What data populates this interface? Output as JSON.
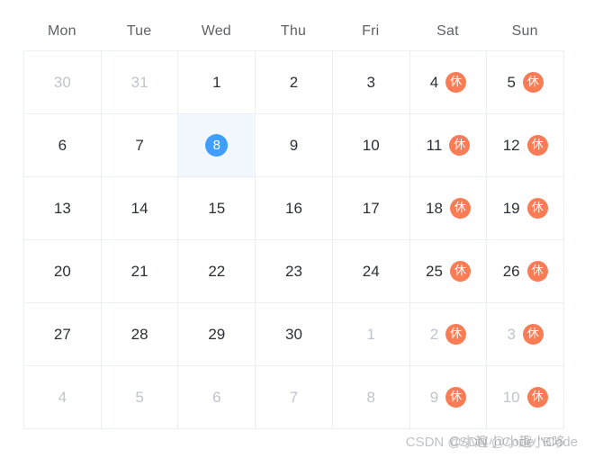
{
  "calendar": {
    "weekdays": [
      "Mon",
      "Tue",
      "Wed",
      "Thu",
      "Fri",
      "Sat",
      "Sun"
    ],
    "holiday_label": "休",
    "today": "8",
    "colors": {
      "today_accent": "#409EFF",
      "today_cell_bg": "#F2F8FE",
      "holiday_badge": "#FA7C55",
      "grid_border": "#EBEEF5",
      "text": "#2C2F34",
      "text_muted": "#C0C4CC",
      "weekday_text": "#606266"
    },
    "rows": [
      [
        {
          "day": "30",
          "adjacent": true,
          "today": false,
          "holiday": false
        },
        {
          "day": "31",
          "adjacent": true,
          "today": false,
          "holiday": false
        },
        {
          "day": "1",
          "adjacent": false,
          "today": false,
          "holiday": false
        },
        {
          "day": "2",
          "adjacent": false,
          "today": false,
          "holiday": false
        },
        {
          "day": "3",
          "adjacent": false,
          "today": false,
          "holiday": false
        },
        {
          "day": "4",
          "adjacent": false,
          "today": false,
          "holiday": true
        },
        {
          "day": "5",
          "adjacent": false,
          "today": false,
          "holiday": true
        }
      ],
      [
        {
          "day": "6",
          "adjacent": false,
          "today": false,
          "holiday": false
        },
        {
          "day": "7",
          "adjacent": false,
          "today": false,
          "holiday": false
        },
        {
          "day": "8",
          "adjacent": false,
          "today": true,
          "holiday": false
        },
        {
          "day": "9",
          "adjacent": false,
          "today": false,
          "holiday": false
        },
        {
          "day": "10",
          "adjacent": false,
          "today": false,
          "holiday": false
        },
        {
          "day": "11",
          "adjacent": false,
          "today": false,
          "holiday": true
        },
        {
          "day": "12",
          "adjacent": false,
          "today": false,
          "holiday": true
        }
      ],
      [
        {
          "day": "13",
          "adjacent": false,
          "today": false,
          "holiday": false
        },
        {
          "day": "14",
          "adjacent": false,
          "today": false,
          "holiday": false
        },
        {
          "day": "15",
          "adjacent": false,
          "today": false,
          "holiday": false
        },
        {
          "day": "16",
          "adjacent": false,
          "today": false,
          "holiday": false
        },
        {
          "day": "17",
          "adjacent": false,
          "today": false,
          "holiday": false
        },
        {
          "day": "18",
          "adjacent": false,
          "today": false,
          "holiday": true
        },
        {
          "day": "19",
          "adjacent": false,
          "today": false,
          "holiday": true
        }
      ],
      [
        {
          "day": "20",
          "adjacent": false,
          "today": false,
          "holiday": false
        },
        {
          "day": "21",
          "adjacent": false,
          "today": false,
          "holiday": false
        },
        {
          "day": "22",
          "adjacent": false,
          "today": false,
          "holiday": false
        },
        {
          "day": "23",
          "adjacent": false,
          "today": false,
          "holiday": false
        },
        {
          "day": "24",
          "adjacent": false,
          "today": false,
          "holiday": false
        },
        {
          "day": "25",
          "adjacent": false,
          "today": false,
          "holiday": true
        },
        {
          "day": "26",
          "adjacent": false,
          "today": false,
          "holiday": true
        }
      ],
      [
        {
          "day": "27",
          "adjacent": false,
          "today": false,
          "holiday": false
        },
        {
          "day": "28",
          "adjacent": false,
          "today": false,
          "holiday": false
        },
        {
          "day": "29",
          "adjacent": false,
          "today": false,
          "holiday": false
        },
        {
          "day": "30",
          "adjacent": false,
          "today": false,
          "holiday": false
        },
        {
          "day": "1",
          "adjacent": true,
          "today": false,
          "holiday": false
        },
        {
          "day": "2",
          "adjacent": true,
          "today": false,
          "holiday": true
        },
        {
          "day": "3",
          "adjacent": true,
          "today": false,
          "holiday": true
        }
      ],
      [
        {
          "day": "4",
          "adjacent": true,
          "today": false,
          "holiday": false
        },
        {
          "day": "5",
          "adjacent": true,
          "today": false,
          "holiday": false
        },
        {
          "day": "6",
          "adjacent": true,
          "today": false,
          "holiday": false
        },
        {
          "day": "7",
          "adjacent": true,
          "today": false,
          "holiday": false
        },
        {
          "day": "8",
          "adjacent": true,
          "today": false,
          "holiday": false
        },
        {
          "day": "9",
          "adjacent": true,
          "today": false,
          "holiday": true
        },
        {
          "day": "10",
          "adjacent": true,
          "today": false,
          "holiday": true
        }
      ]
    ]
  },
  "watermark": {
    "line_a": "CSDN @小趣小Code",
    "line_b": "CSDN @小趣小Code \"B哆"
  }
}
